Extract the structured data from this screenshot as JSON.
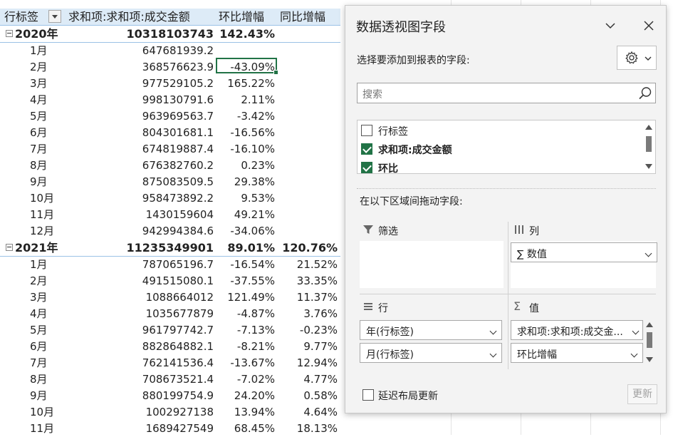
{
  "pivot": {
    "headers": {
      "row_label": "行标签",
      "sum": "求和项:求和项:成交金额",
      "mom": "环比增幅",
      "yoy": "同比增幅"
    },
    "groups": [
      {
        "year": "2020年",
        "amount": "10318103743",
        "mom": "142.43%",
        "yoy": "",
        "months": [
          {
            "month": "1月",
            "amount": "647681939.2",
            "mom": "",
            "yoy": ""
          },
          {
            "month": "2月",
            "amount": "368576623.9",
            "mom": "-43.09%",
            "yoy": ""
          },
          {
            "month": "3月",
            "amount": "977529105.2",
            "mom": "165.22%",
            "yoy": ""
          },
          {
            "month": "4月",
            "amount": "998130791.6",
            "mom": "2.11%",
            "yoy": ""
          },
          {
            "month": "5月",
            "amount": "963969563.7",
            "mom": "-3.42%",
            "yoy": ""
          },
          {
            "month": "6月",
            "amount": "804301681.1",
            "mom": "-16.56%",
            "yoy": ""
          },
          {
            "month": "7月",
            "amount": "674819887.4",
            "mom": "-16.10%",
            "yoy": ""
          },
          {
            "month": "8月",
            "amount": "676382760.2",
            "mom": "0.23%",
            "yoy": ""
          },
          {
            "month": "9月",
            "amount": "875083509.5",
            "mom": "29.38%",
            "yoy": ""
          },
          {
            "month": "10月",
            "amount": "958473892.2",
            "mom": "9.53%",
            "yoy": ""
          },
          {
            "month": "11月",
            "amount": "1430159604",
            "mom": "49.21%",
            "yoy": ""
          },
          {
            "month": "12月",
            "amount": "942994384.6",
            "mom": "-34.06%",
            "yoy": ""
          }
        ]
      },
      {
        "year": "2021年",
        "amount": "11235349901",
        "mom": "89.01%",
        "yoy": "120.76%",
        "months": [
          {
            "month": "1月",
            "amount": "787065196.7",
            "mom": "-16.54%",
            "yoy": "21.52%"
          },
          {
            "month": "2月",
            "amount": "491515080.1",
            "mom": "-37.55%",
            "yoy": "33.35%"
          },
          {
            "month": "3月",
            "amount": "1088664012",
            "mom": "121.49%",
            "yoy": "11.37%"
          },
          {
            "month": "4月",
            "amount": "1035677879",
            "mom": "-4.87%",
            "yoy": "3.76%"
          },
          {
            "month": "5月",
            "amount": "961797742.7",
            "mom": "-7.13%",
            "yoy": "-0.23%"
          },
          {
            "month": "6月",
            "amount": "882864882.1",
            "mom": "-8.21%",
            "yoy": "9.77%"
          },
          {
            "month": "7月",
            "amount": "762141536.4",
            "mom": "-13.67%",
            "yoy": "12.94%"
          },
          {
            "month": "8月",
            "amount": "708673521.4",
            "mom": "-7.02%",
            "yoy": "4.77%"
          },
          {
            "month": "9月",
            "amount": "880199754.9",
            "mom": "24.20%",
            "yoy": "0.58%"
          },
          {
            "month": "10月",
            "amount": "1002927138",
            "mom": "13.94%",
            "yoy": "4.64%"
          },
          {
            "month": "11月",
            "amount": "1689427549",
            "mom": "68.45%",
            "yoy": "18.13%"
          }
        ]
      }
    ]
  },
  "pane": {
    "title": "数据透视图字段",
    "choose_label": "选择要添加到报表的字段:",
    "search_placeholder": "搜索",
    "fields": [
      {
        "label": "行标签",
        "checked": false,
        "bold": false
      },
      {
        "label": "求和项:成交金额",
        "checked": true,
        "bold": true
      },
      {
        "label": "环比",
        "checked": true,
        "bold": true
      }
    ],
    "drag_label": "在以下区域间拖动字段:",
    "areas": {
      "filter": {
        "title": "筛选",
        "items": []
      },
      "columns": {
        "title": "列",
        "items": [
          "数值"
        ]
      },
      "rows": {
        "title": "行",
        "items": [
          "年(行标签)",
          "月(行标签)"
        ]
      },
      "values": {
        "title": "值",
        "items": [
          "求和项:求和项:成交金...",
          "环比增幅"
        ]
      }
    },
    "defer_label": "延迟布局更新",
    "update_label": "更新"
  },
  "colors": {
    "header_bg": "#ddebf7",
    "header_border": "#9bc2e6",
    "accent": "#217346",
    "pane_bg": "#f3f3f3"
  }
}
